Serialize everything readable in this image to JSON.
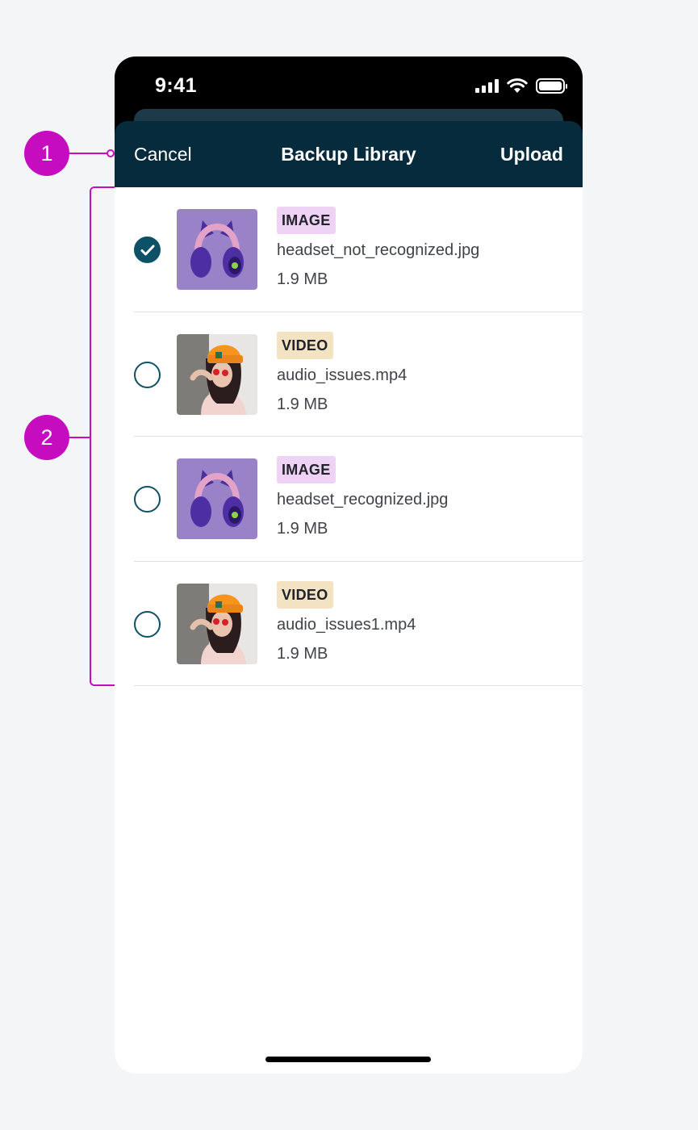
{
  "status_bar": {
    "time": "9:41"
  },
  "nav": {
    "cancel_label": "Cancel",
    "title": "Backup Library",
    "upload_label": "Upload"
  },
  "annotations": {
    "one": "1",
    "two": "2"
  },
  "files": [
    {
      "type": "IMAGE",
      "kind": "image",
      "name": "headset_not_recognized.jpg",
      "size": "1.9 MB",
      "selected": true,
      "thumb_icon": "headphones-thumbnail"
    },
    {
      "type": "VIDEO",
      "kind": "video",
      "name": "audio_issues.mp4",
      "size": "1.9 MB",
      "selected": false,
      "thumb_icon": "person-thumbnail"
    },
    {
      "type": "IMAGE",
      "kind": "image",
      "name": "headset_recognized.jpg",
      "size": "1.9 MB",
      "selected": false,
      "thumb_icon": "headphones-thumbnail"
    },
    {
      "type": "VIDEO",
      "kind": "video",
      "name": "audio_issues1.mp4",
      "size": "1.9 MB",
      "selected": false,
      "thumb_icon": "person-thumbnail"
    }
  ],
  "colors": {
    "annotation": "#c50dbf",
    "nav_background": "#062b3c",
    "radio": "#0d5166",
    "image_tag": "#eed3f4",
    "video_tag": "#f3e3c3"
  }
}
